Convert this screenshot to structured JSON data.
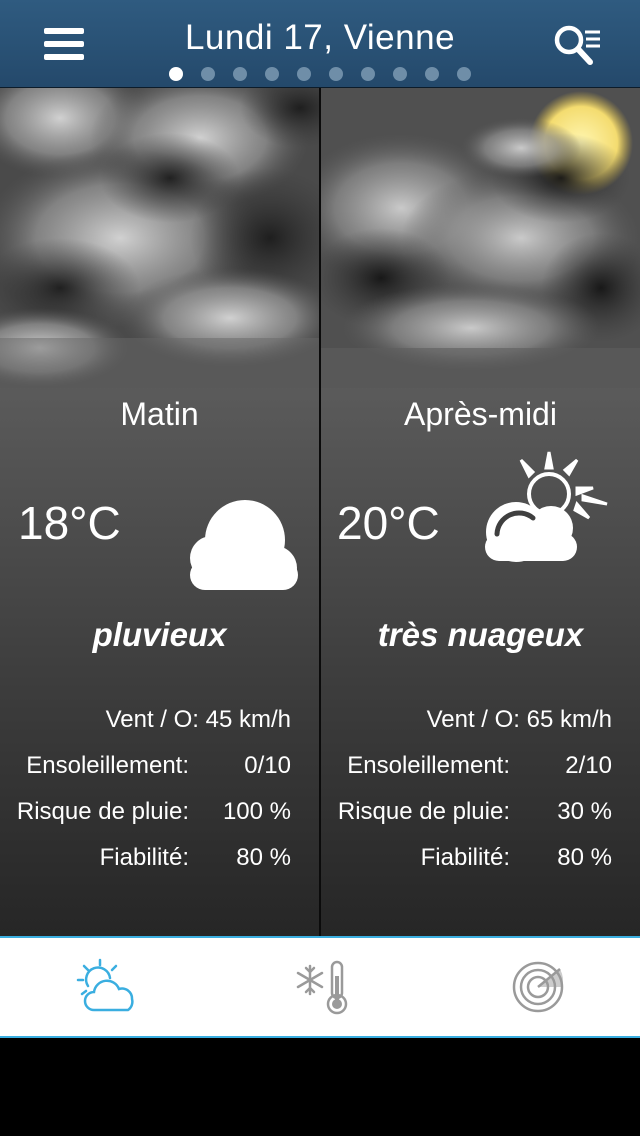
{
  "header": {
    "title": "Lundi 17, Vienne",
    "menu_icon": "hamburger-menu-icon",
    "search_icon": "search-list-icon",
    "page_count": 10,
    "active_page": 0
  },
  "colors": {
    "header_bg": "#2b5679",
    "accent": "#3aaee0",
    "inactive_icon": "#9a9a9a"
  },
  "panels": [
    {
      "period": "Matin",
      "temperature": "18°C",
      "icon": "rain-cloud-icon",
      "condition": "pluvieux",
      "wind": "Vent / O:  45 km/h",
      "details": [
        {
          "label": "Ensoleillement:",
          "value": "0/10"
        },
        {
          "label": "Risque de pluie:",
          "value": "100 %"
        },
        {
          "label": "Fiabilité:",
          "value": "80 %"
        }
      ]
    },
    {
      "period": "Après-midi",
      "temperature": "20°C",
      "icon": "sun-behind-cloud-icon",
      "condition": "très nuageux",
      "wind": "Vent / O:  65 km/h",
      "details": [
        {
          "label": "Ensoleillement:",
          "value": "2/10"
        },
        {
          "label": "Risque de pluie:",
          "value": "30 %"
        },
        {
          "label": "Fiabilité:",
          "value": "80 %"
        }
      ]
    }
  ],
  "tabbar": {
    "tabs": [
      {
        "icon": "sun-cloud-tab-icon",
        "active": true
      },
      {
        "icon": "snow-thermometer-tab-icon",
        "active": false
      },
      {
        "icon": "radar-tab-icon",
        "active": false
      }
    ]
  }
}
